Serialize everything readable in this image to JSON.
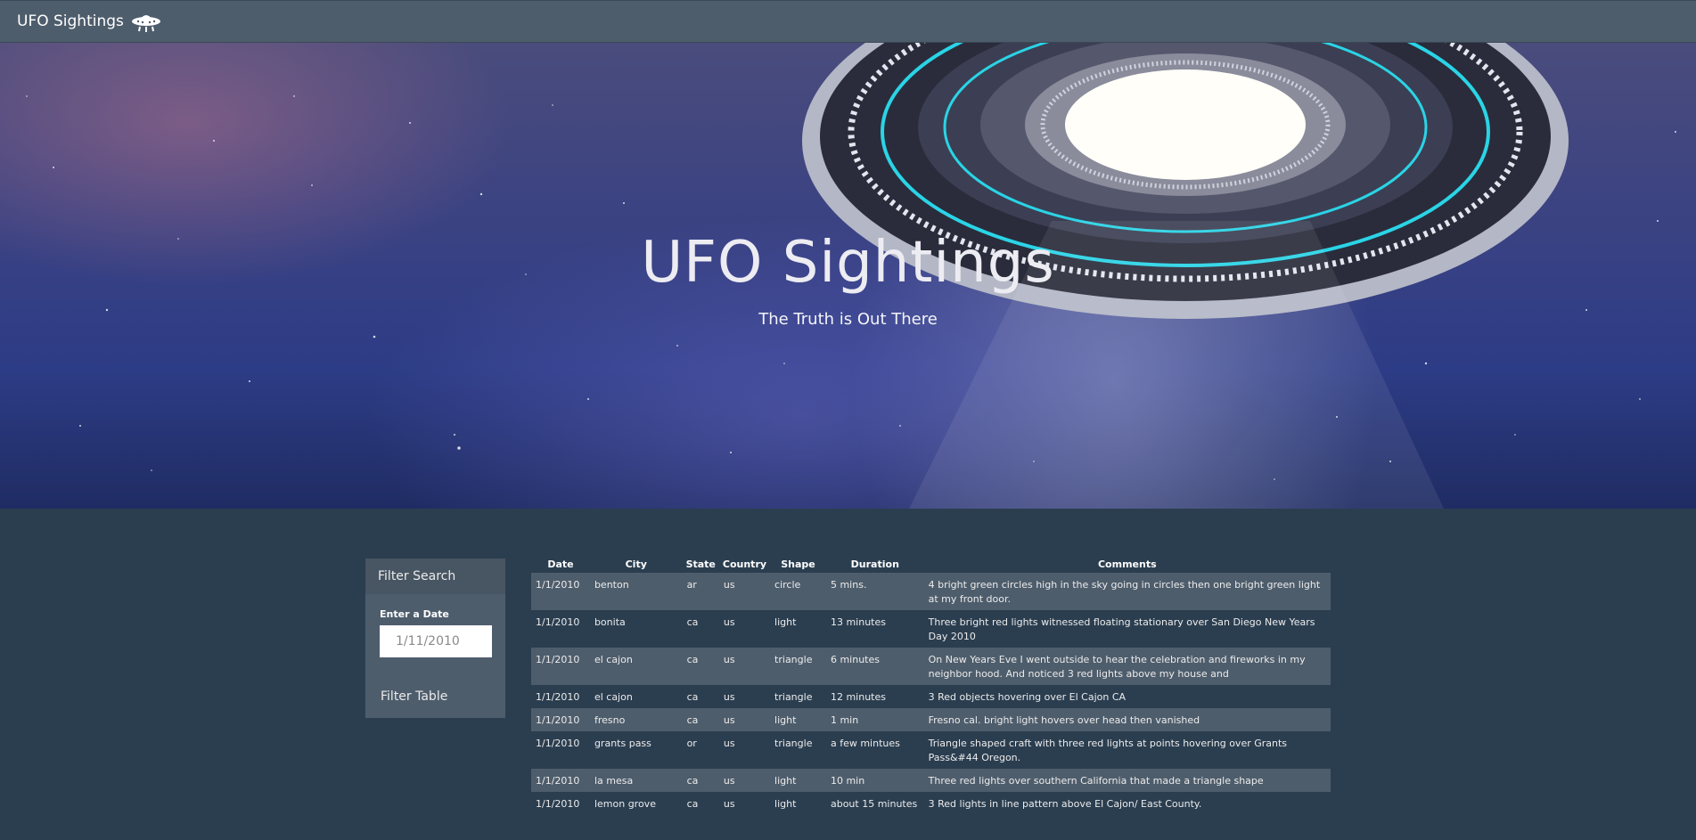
{
  "navbar": {
    "brand": "UFO Sightings",
    "brand_icon": "ufo-icon"
  },
  "hero": {
    "title": "UFO Sightings",
    "subtitle": "The Truth is Out There"
  },
  "sidebar": {
    "heading": "Filter Search",
    "date_label": "Enter a Date",
    "date_placeholder": "1/11/2010",
    "filter_button": "Filter Table"
  },
  "table": {
    "headers": [
      "Date",
      "City",
      "State",
      "Country",
      "Shape",
      "Duration",
      "Comments"
    ],
    "rows": [
      [
        "1/1/2010",
        "benton",
        "ar",
        "us",
        "circle",
        "5 mins.",
        "4 bright green circles high in the sky going in circles then one bright green light at my front door."
      ],
      [
        "1/1/2010",
        "bonita",
        "ca",
        "us",
        "light",
        "13 minutes",
        "Three bright red lights witnessed floating stationary over San Diego New Years Day 2010"
      ],
      [
        "1/1/2010",
        "el cajon",
        "ca",
        "us",
        "triangle",
        "6 minutes",
        "On New Years Eve I went outside to hear the celebration and fireworks in my neighbor hood. And noticed 3 red lights above my house and"
      ],
      [
        "1/1/2010",
        "el cajon",
        "ca",
        "us",
        "triangle",
        "12 minutes",
        "3 Red objects hovering over El Cajon CA"
      ],
      [
        "1/1/2010",
        "fresno",
        "ca",
        "us",
        "light",
        "1 min",
        "Fresno cal. bright light hovers over head then vanished"
      ],
      [
        "1/1/2010",
        "grants pass",
        "or",
        "us",
        "triangle",
        "a few mintues",
        "Triangle shaped craft with three red lights at points hovering over Grants Pass&#44 Oregon."
      ],
      [
        "1/1/2010",
        "la mesa",
        "ca",
        "us",
        "light",
        "10 min",
        "Three red lights over southern California that made a triangle shape"
      ],
      [
        "1/1/2010",
        "lemon grove",
        "ca",
        "us",
        "light",
        "about 15 minutes",
        "3 Red lights in line pattern above El Cajon/ East County."
      ]
    ]
  },
  "colors": {
    "navbar": "#4e5d6c",
    "page_background": "#2b3e50",
    "row_stripe": "#4e5d6c",
    "saucer_accent": "#2ad4e6"
  }
}
